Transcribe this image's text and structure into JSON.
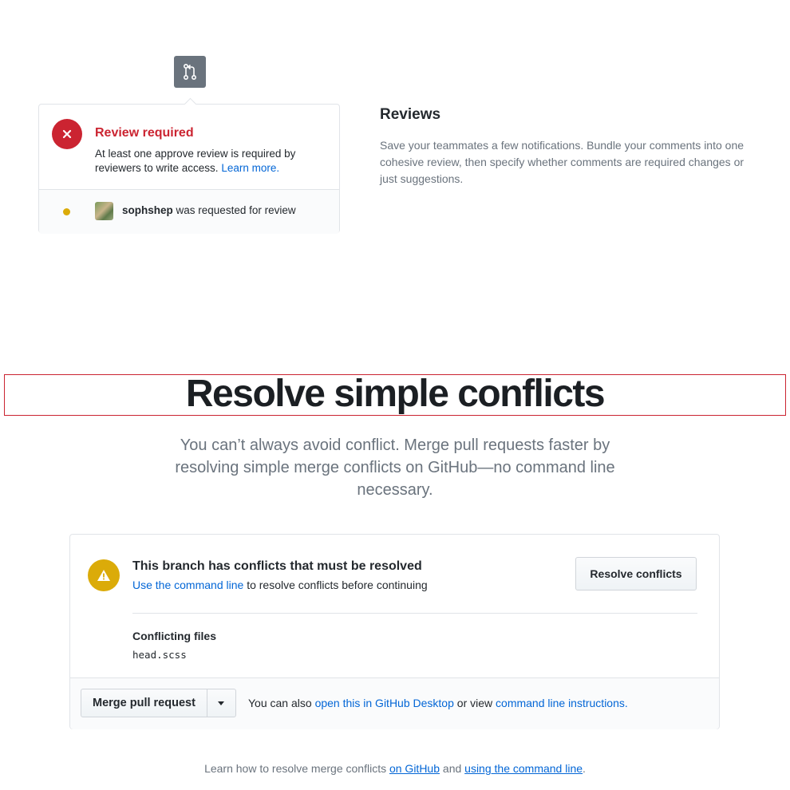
{
  "reviews_demo": {
    "review_title": "Review required",
    "review_desc": "At least one approve review is required by reviewers to write access.",
    "learn_more": "Learn more.",
    "reviewer_name": "sophshep",
    "reviewer_text": "was requested for review"
  },
  "reviews_feature": {
    "heading": "Reviews",
    "description": "Save your teammates a few notifications. Bundle your comments into one cohesive review, then specify whether comments are required changes or just suggestions."
  },
  "resolve": {
    "title": "Resolve simple conflicts",
    "subtitle": "You can’t always avoid conflict. Merge pull requests faster by resolving simple merge conflicts on GitHub—no command line necessary."
  },
  "merge_box": {
    "conflict_title": "This branch has conflicts that must be resolved",
    "command_line_link": "Use the command line",
    "conflict_sub_rest": "to resolve conflicts before continuing",
    "resolve_button": "Resolve conflicts",
    "conflicting_label": "Conflicting files",
    "conflicting_file": "head.scss",
    "merge_button": "Merge pull request",
    "footer_prefix": "You can also",
    "footer_link1": "open this in GitHub Desktop",
    "footer_mid": "or view",
    "footer_link2": "command line instructions."
  },
  "learn": {
    "prefix": "Learn how to resolve merge conflicts",
    "link1": "on GitHub",
    "mid": "and",
    "link2": "using the command line",
    "suffix": "."
  },
  "colors": {
    "error_red": "#cb2431",
    "warning_yellow": "#dbab09",
    "link_blue": "#0366d6",
    "muted_gray": "#6a737d"
  },
  "icons": [
    "git-pull-request-icon",
    "x-icon",
    "alert-icon",
    "triangle-down-icon"
  ]
}
